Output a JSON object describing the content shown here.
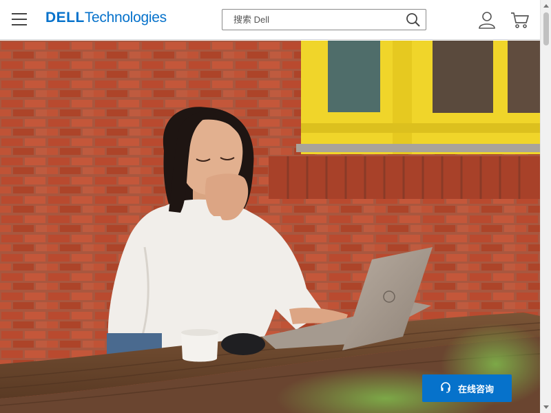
{
  "header": {
    "logo_primary": "DELL",
    "logo_secondary": "Technologies",
    "search": {
      "placeholder": "搜索 Dell",
      "value": ""
    },
    "icons": {
      "menu": "hamburger-menu-icon",
      "search": "search-icon",
      "account": "user-icon",
      "cart": "cart-icon"
    }
  },
  "hero": {
    "image_description": "woman laughing at laptop on wooden table in front of brick wall with yellow window"
  },
  "chat": {
    "label": "在线咨询",
    "icon": "headset-icon"
  },
  "colors": {
    "brand": "#0672cb",
    "brick": "#b5482c",
    "window_frame": "#f2d92a"
  }
}
